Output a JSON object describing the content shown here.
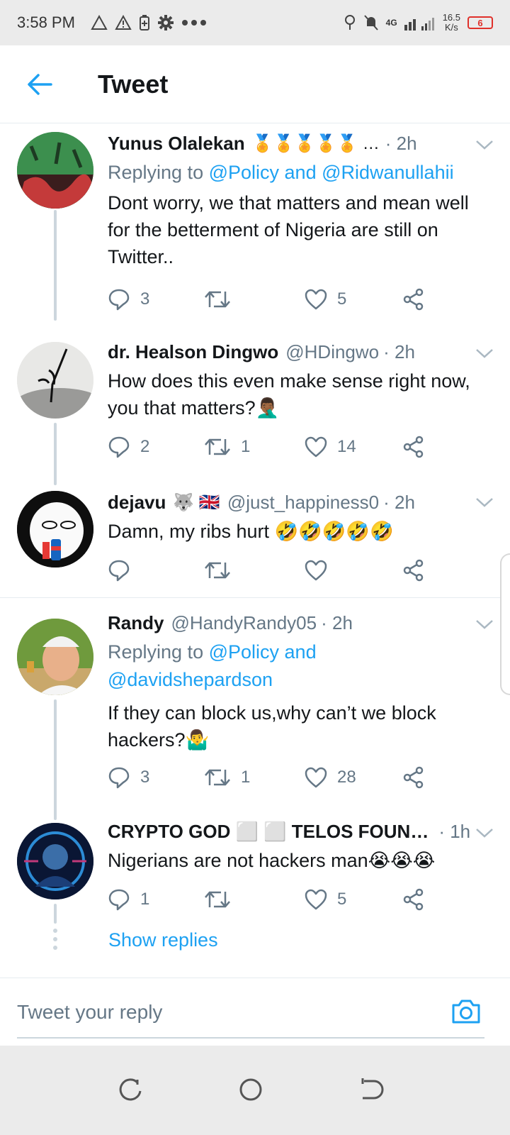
{
  "status_bar": {
    "time": "3:58 PM",
    "network": "4G",
    "speed_value": "16.5",
    "speed_unit": "K/s",
    "battery": "6"
  },
  "header": {
    "title": "Tweet"
  },
  "tweets": [
    {
      "name": "Yunus Olalekan",
      "name_emoji": "🏅🏅🏅🏅🏅 …",
      "handle": "",
      "time": "· 2h",
      "replying_prefix": "Replying to",
      "replying_links": "@Policy and @Ridwanullahii",
      "text": "Dont worry, we that matters and mean well for the betterment of Nigeria are still on Twitter..",
      "replies": "3",
      "retweets": "",
      "likes": "5"
    },
    {
      "name": "dr. Healson Dingwo",
      "handle": "@HDingwo",
      "time": "· 2h",
      "text": "How does this even make sense right now, you that matters?🤦🏾‍♂️",
      "replies": "2",
      "retweets": "1",
      "likes": "14"
    },
    {
      "name": "dejavu",
      "name_emoji": "🐺 🇬🇧",
      "handle": "@just_happiness0",
      "time": "· 2h",
      "text": "Damn, my ribs hurt 🤣🤣🤣🤣🤣",
      "replies": "",
      "retweets": "",
      "likes": ""
    },
    {
      "name": "Randy",
      "handle": "@HandyRandy05",
      "time": "· 2h",
      "replying_prefix": "Replying to",
      "replying_links_1": "@Policy and",
      "replying_links_2": "@davidshepardson",
      "text": "If they can block us,why  can’t we block hackers?🤷‍♂️",
      "replies": "3",
      "retweets": "1",
      "likes": "28"
    },
    {
      "name": "CRYPTO GOD ⬜ ⬜ TELOS FOUN…",
      "handle": "",
      "time": "· 1h",
      "text": "Nigerians are not hackers man😭😭😭",
      "replies": "1",
      "retweets": "",
      "likes": "5"
    }
  ],
  "show_replies": "Show replies",
  "reply_bar": {
    "placeholder": "Tweet your reply"
  },
  "icons": {
    "back": "arrow-left-icon",
    "camera": "camera-icon",
    "reply": "speech-bubble-icon",
    "retweet": "retweet-icon",
    "like": "heart-icon",
    "share": "share-icon"
  },
  "colors": {
    "accent": "#1da1f2",
    "secondary_text": "#657786",
    "primary_text": "#14171a",
    "battery_low": "#e0302a"
  }
}
